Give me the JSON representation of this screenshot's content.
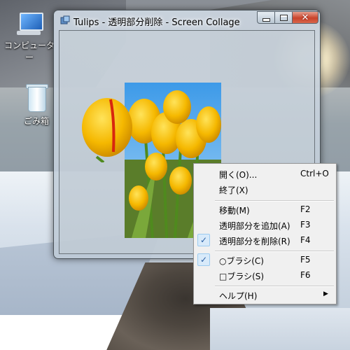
{
  "desktop": {
    "icons": [
      {
        "label": "コンピューター"
      },
      {
        "label": "ごみ箱"
      }
    ]
  },
  "window": {
    "title": "Tulips - 透明部分削除 - Screen Collage",
    "close_glyph": "✕"
  },
  "menu": {
    "items": [
      {
        "label": "開く(O)...",
        "accel": "Ctrl+O",
        "checked": false
      },
      {
        "label": "終了(X)",
        "accel": "",
        "checked": false
      },
      {
        "label": "移動(M)",
        "accel": "F2",
        "checked": false
      },
      {
        "label": "透明部分を追加(A)",
        "accel": "F3",
        "checked": false
      },
      {
        "label": "透明部分を削除(R)",
        "accel": "F4",
        "checked": true
      },
      {
        "label": "○ブラシ(C)",
        "accel": "F5",
        "checked": true
      },
      {
        "label": "□ブラシ(S)",
        "accel": "F6",
        "checked": false
      },
      {
        "label": "ヘルプ(H)",
        "accel": "",
        "checked": false,
        "submenu_glyph": "▶"
      }
    ],
    "check_glyph": "✓"
  },
  "colors": {
    "accent": "#2a5fa3",
    "check_bg": "#d8eafa",
    "close_button": "#c9432a"
  }
}
